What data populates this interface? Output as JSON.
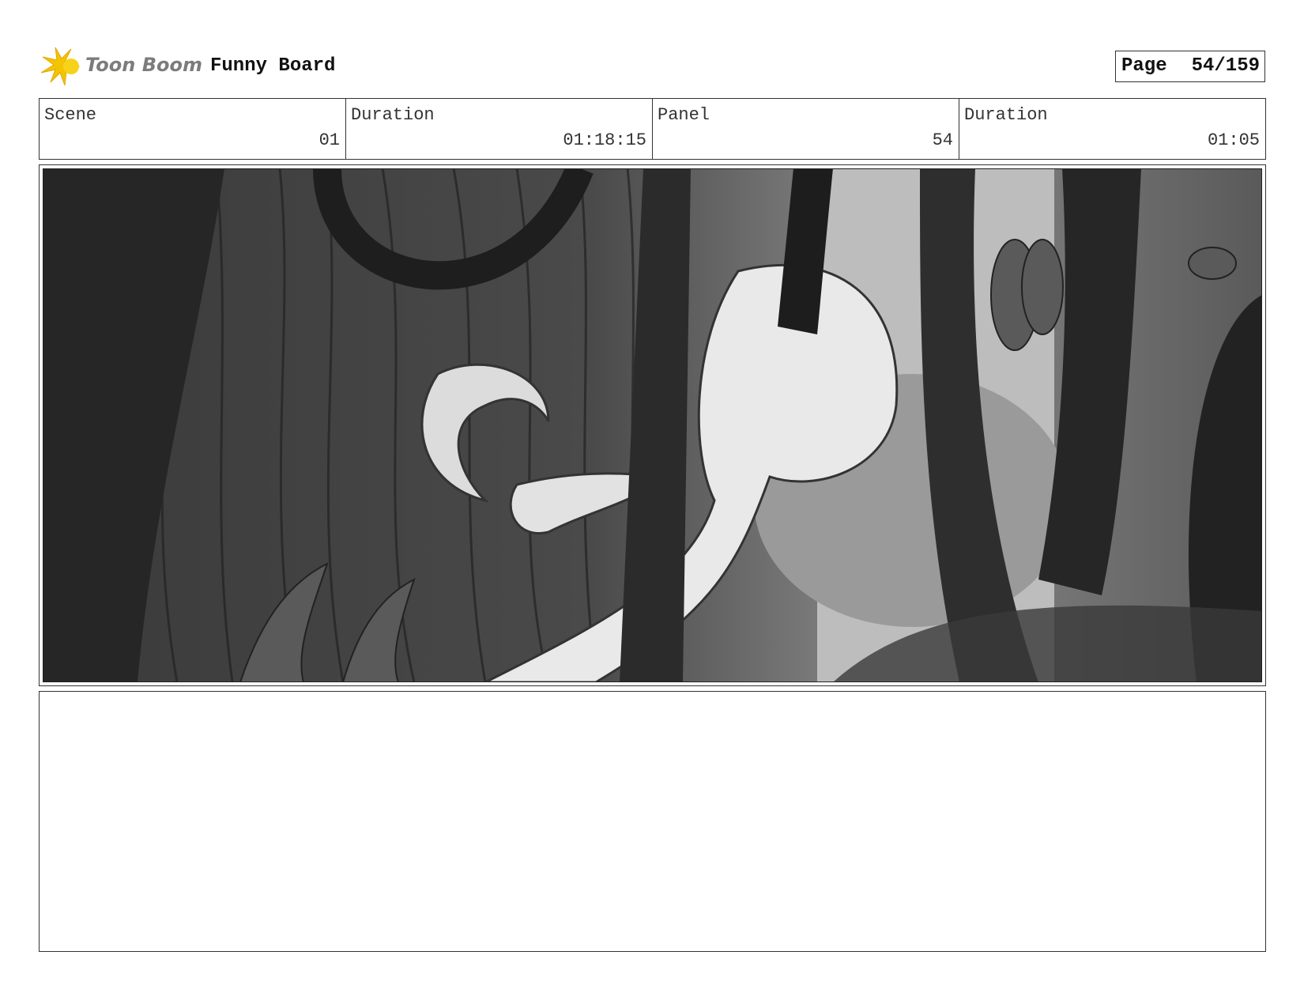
{
  "header": {
    "logo_text": "Toon Boom",
    "board_title": "Funny Board",
    "page_label": "Page",
    "page_value": "54/159"
  },
  "info": [
    {
      "label": "Scene",
      "value": "01"
    },
    {
      "label": "Duration",
      "value": "01:18:15"
    },
    {
      "label": "Panel",
      "value": "54"
    },
    {
      "label": "Duration",
      "value": "01:05"
    }
  ],
  "panel": {
    "image_name": "jungle-sketch-panel"
  },
  "notes": {
    "text": ""
  },
  "colors": {
    "logo_star": "#f5c400",
    "logo_text": "#7c7c7c",
    "border": "#333333"
  }
}
